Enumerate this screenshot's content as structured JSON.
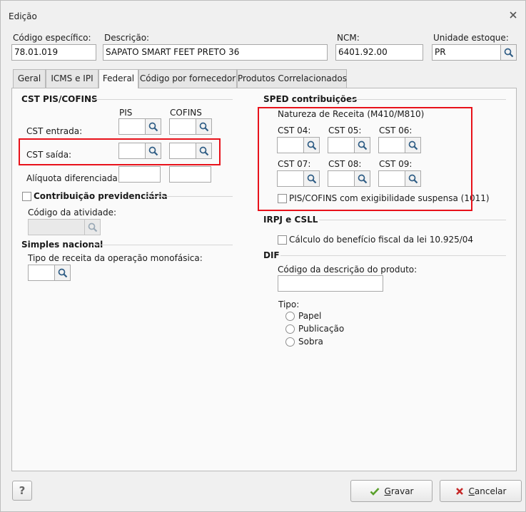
{
  "window": {
    "title": "Edição"
  },
  "header": {
    "codigo": {
      "label": "Código específico:",
      "value": "78.01.019"
    },
    "descricao": {
      "label": "Descrição:",
      "value": "SAPATO SMART FEET PRETO 36"
    },
    "ncm": {
      "label": "NCM:",
      "value": "6401.92.00"
    },
    "unidade": {
      "label": "Unidade estoque:",
      "value": "PR"
    }
  },
  "tabs": [
    {
      "label": "Geral"
    },
    {
      "label": "ICMS e IPI"
    },
    {
      "label": "Federal"
    },
    {
      "label": "Código por fornecedor"
    },
    {
      "label": "Produtos Correlacionados"
    }
  ],
  "cst": {
    "section_title": "CST PIS/COFINS",
    "col_pis": "PIS",
    "col_cofins": "COFINS",
    "entrada_label": "CST entrada:",
    "saida_label": "CST saída:",
    "aliquota_label": "Alíquota diferenciada:"
  },
  "previdenciaria": {
    "checkbox_label": "Contribuição previdenciária",
    "atividade_label": "Código da atividade:"
  },
  "simples": {
    "section_title": "Simples nacional",
    "tipo_label": "Tipo de receita da operação monofásica:"
  },
  "sped": {
    "section_title": "SPED contribuições",
    "natureza_label": "Natureza de Receita (M410/M810)",
    "cst04": "CST 04:",
    "cst05": "CST 05:",
    "cst06": "CST 06:",
    "cst07": "CST 07:",
    "cst08": "CST 08:",
    "cst09": "CST 09:",
    "suspensa_label": "PIS/COFINS com exigibilidade suspensa (1011)"
  },
  "irpj": {
    "section_title": "IRPJ e CSLL",
    "calculo_label": "Cálculo do benefício fiscal da lei 10.925/04"
  },
  "dif": {
    "section_title": "DIF",
    "codigo_label": "Código da descrição do produto:",
    "tipo_label": "Tipo:",
    "options": [
      "Papel",
      "Publicação",
      "Sobra"
    ]
  },
  "footer": {
    "help_label": "?",
    "gravar_first": "G",
    "gravar_rest": "ravar",
    "cancelar_first": "C",
    "cancelar_rest": "ancelar"
  },
  "colors": {
    "highlight": "#e8111a",
    "check": "#5aa02c",
    "cancel": "#c62828"
  },
  "icons": [
    "close-icon",
    "search-icon",
    "checkmark-icon",
    "cancel-x-icon",
    "help-icon"
  ]
}
